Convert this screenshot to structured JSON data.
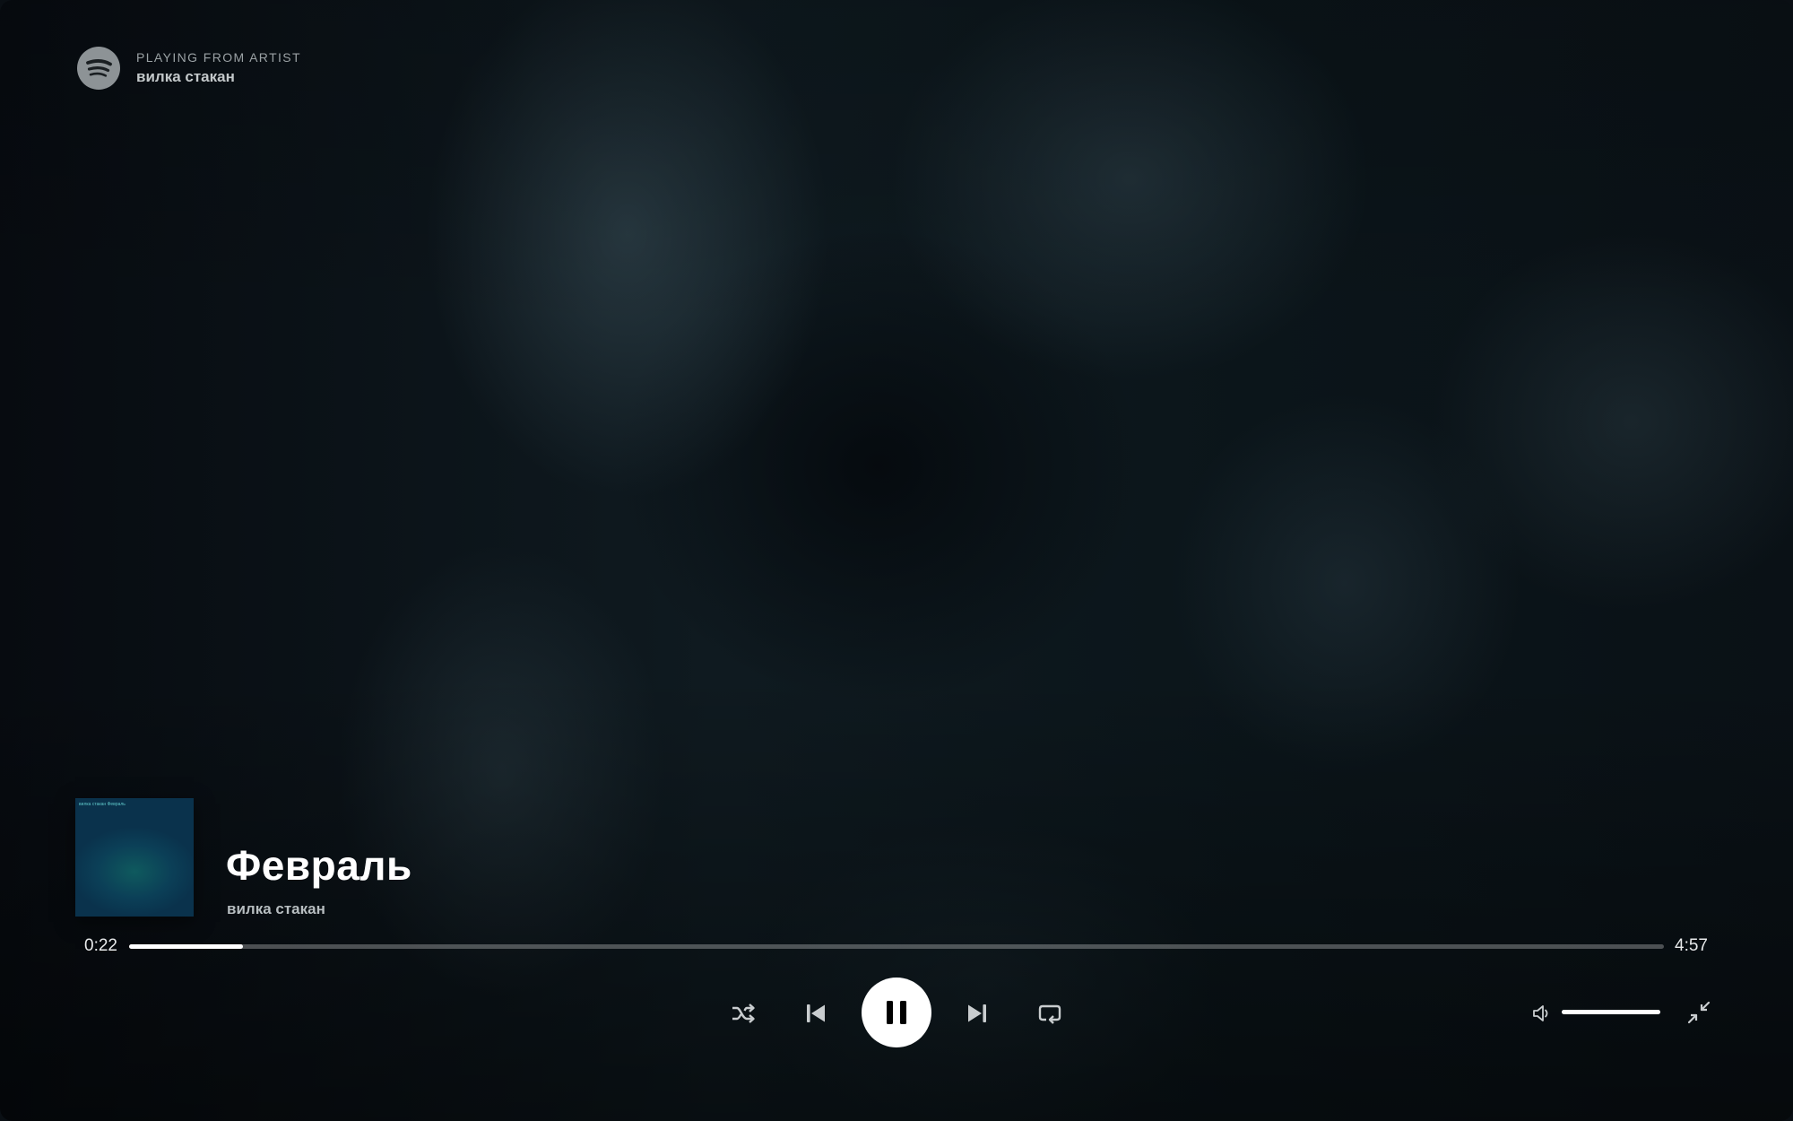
{
  "context": {
    "label": "PLAYING FROM ARTIST",
    "name": "вилка стакан",
    "logo_icon": "spotify-logo-icon"
  },
  "track": {
    "title": "Февраль",
    "artist": "вилка стакан",
    "cover_text": "вилка стакан Февраль"
  },
  "playback": {
    "elapsed": "0:22",
    "duration": "4:57",
    "progress_fraction": 0.074,
    "state": "playing"
  },
  "controls": {
    "shuffle_icon": "shuffle-icon",
    "previous_icon": "previous-icon",
    "pause_icon": "pause-icon",
    "next_icon": "next-icon",
    "repeat_icon": "repeat-icon",
    "volume_icon": "volume-icon",
    "exit_fullscreen_icon": "minimize-icon"
  },
  "volume": {
    "level_fraction": 1.0
  },
  "colors": {
    "text_primary": "#ffffff",
    "text_secondary": "#b7bdc0",
    "track_bg": "rgba(255,255,255,0.28)",
    "accent": "#ffffff"
  }
}
